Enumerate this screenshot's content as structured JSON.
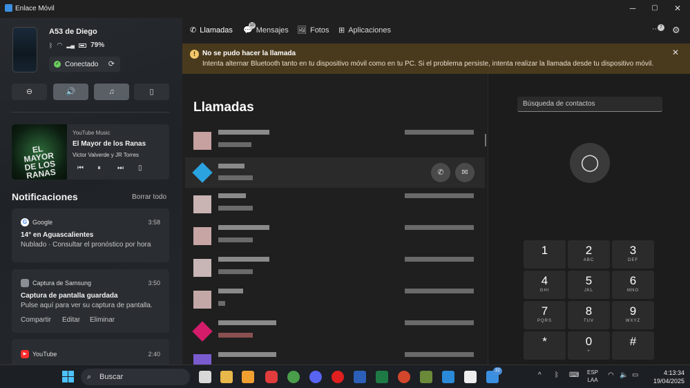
{
  "window": {
    "title": "Enlace Móvil",
    "minimize": "─",
    "maximize": "▢",
    "close": "✕"
  },
  "device": {
    "name": "A53 de Diego",
    "battery": "79%",
    "status": "Conectado",
    "sync_icon": "⟳"
  },
  "quick_actions": [
    {
      "name": "dnd",
      "glyph": "⊖"
    },
    {
      "name": "volume",
      "glyph": "🔊"
    },
    {
      "name": "music",
      "glyph": "♫"
    },
    {
      "name": "phone-audio",
      "glyph": "▯"
    }
  ],
  "media": {
    "source": "YouTube Music",
    "title": "El Mayor de los Ranas",
    "artist": "Victor Valverde y JR Torres",
    "album_art_text": "EL MAYOR DE LOS RANAS",
    "prev": "⏮",
    "pause": "⏸",
    "next": "⏭",
    "device": "▯"
  },
  "notifications": {
    "header": "Notificaciones",
    "clear_all": "Borrar todo",
    "items": [
      {
        "app": "Google",
        "time": "3:58",
        "title": "14° en Aguascalientes",
        "body": "Nublado · Consultar el pronóstico por hora",
        "icon_color": "#ffffff"
      },
      {
        "app": "Captura de Samsung",
        "time": "3:50",
        "title": "Captura de pantalla guardada",
        "body": "Pulse aquí para ver su captura de pantalla.",
        "actions": [
          "Compartir",
          "Editar",
          "Eliminar"
        ],
        "icon_color": "#8a8f96"
      },
      {
        "app": "YouTube",
        "time": "2:40",
        "icon_color": "#ff2d2d"
      }
    ]
  },
  "tabs": [
    {
      "label": "Llamadas",
      "icon": "✆",
      "active": true
    },
    {
      "label": "Mensajes",
      "icon": "💬",
      "badge": "10"
    },
    {
      "label": "Fotos",
      "icon": "🖼"
    },
    {
      "label": "Aplicaciones",
      "icon": "⊞"
    }
  ],
  "toolbar": {
    "more": "···",
    "more_badge": "7",
    "settings": "⚙"
  },
  "alert": {
    "title": "No se pudo hacer la llamada",
    "body": "Intenta alternar Bluetooth tanto en tu dispositivo móvil como en tu PC. Si el problema persiste, intenta realizar la llamada desde tu dispositivo móvil.",
    "icon": "!",
    "close": "✕"
  },
  "calls": {
    "header": "Llamadas",
    "call_button": "✆",
    "message_button": "✉",
    "avatar_colors": [
      "#c7a0a0",
      "#2aa3e0",
      "#c9b3b3",
      "#c7a5a5",
      "#c8b6b6",
      "#c4a8a8",
      "#d41c6a",
      "#7a5cd0"
    ]
  },
  "dialer": {
    "search_placeholder": "Búsqueda de contactos",
    "contact_icon": "👤",
    "keys": [
      {
        "digit": "1",
        "letters": ""
      },
      {
        "digit": "2",
        "letters": "ABC"
      },
      {
        "digit": "3",
        "letters": "DEF"
      },
      {
        "digit": "4",
        "letters": "GHI"
      },
      {
        "digit": "5",
        "letters": "JKL"
      },
      {
        "digit": "6",
        "letters": "MNO"
      },
      {
        "digit": "7",
        "letters": "PQRS"
      },
      {
        "digit": "8",
        "letters": "TUV"
      },
      {
        "digit": "9",
        "letters": "WXYZ"
      },
      {
        "digit": "*",
        "letters": ""
      },
      {
        "digit": "0",
        "letters": "+"
      },
      {
        "digit": "#",
        "letters": ""
      }
    ]
  },
  "taskbar": {
    "search_label": "Buscar",
    "search_icon": "⌕",
    "apps": [
      {
        "name": "file-explorer",
        "color": "#e8b84a"
      },
      {
        "name": "media-player",
        "color": "#f0a030"
      },
      {
        "name": "vivaldi",
        "color": "#e03c3c"
      },
      {
        "name": "chrome",
        "color": "#4a9d4a"
      },
      {
        "name": "discord",
        "color": "#5865f2"
      },
      {
        "name": "youtube-music",
        "color": "#e02020"
      },
      {
        "name": "word",
        "color": "#2b5fb8"
      },
      {
        "name": "excel",
        "color": "#1e7a45"
      },
      {
        "name": "powerpoint",
        "color": "#d2472c"
      },
      {
        "name": "minecraft",
        "color": "#6a8a3a"
      },
      {
        "name": "vscode",
        "color": "#2a8ad8"
      },
      {
        "name": "notion",
        "color": "#eeeeee"
      },
      {
        "name": "phone-link",
        "color": "#3b8fe0"
      }
    ],
    "phone_link_badge": "22",
    "tray": {
      "chevron": "^",
      "bluetooth": "ᛒ",
      "keyboard": "⌨",
      "lang": "ESP",
      "layout": "LAA",
      "wifi": "◠",
      "volume": "🔈",
      "battery": "▭"
    },
    "time": "4:13:34",
    "date": "19/04/2025"
  }
}
